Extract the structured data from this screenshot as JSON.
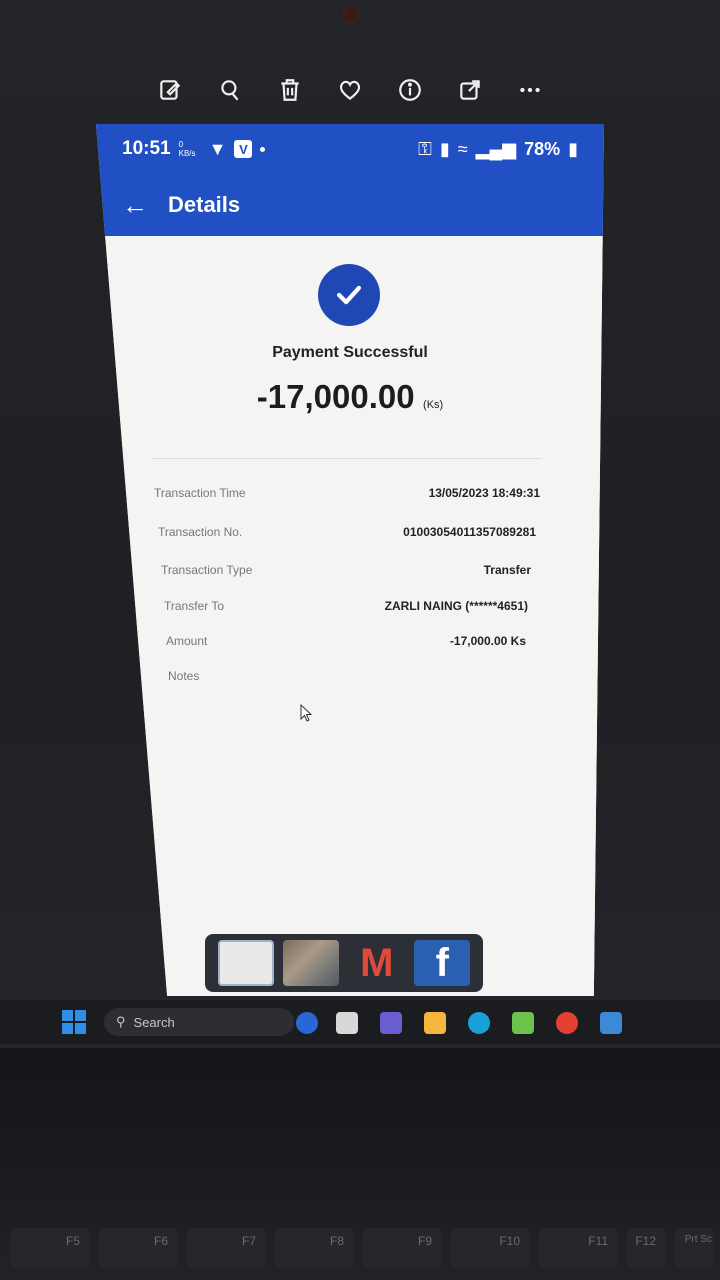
{
  "status_bar": {
    "time": "10:51",
    "net_speed": "0 KB/s",
    "battery": "78%"
  },
  "app_bar": {
    "title": "Details"
  },
  "receipt": {
    "status": "Payment Successful",
    "amount": "-17,000.00",
    "currency": "(Ks)"
  },
  "details": [
    {
      "label": "Transaction Time",
      "value": "13/05/2023 18:49:31"
    },
    {
      "label": "Transaction No.",
      "value": "01003054011357089281"
    },
    {
      "label": "Transaction Type",
      "value": "Transfer"
    },
    {
      "label": "Transfer To",
      "value": "ZARLI NAING (******4651)"
    },
    {
      "label": "Amount",
      "value": "-17,000.00 Ks"
    },
    {
      "label": "Notes",
      "value": ""
    }
  ],
  "windows_taskbar": {
    "search_placeholder": "Search"
  },
  "keyboard": {
    "fkeys": [
      "F5",
      "F6",
      "F7",
      "F8",
      "F9",
      "F10",
      "F11",
      "F12",
      "Prt Sc"
    ]
  },
  "colors": {
    "brand_blue": "#2150c4",
    "success_circle": "#1f48b5"
  }
}
